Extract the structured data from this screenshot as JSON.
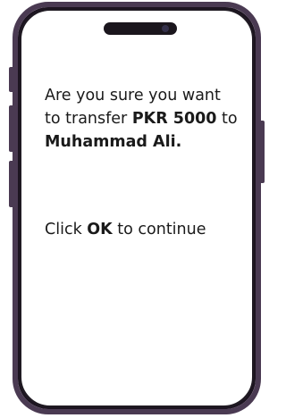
{
  "dialog": {
    "line1": "Are you sure you want",
    "line2_prefix": "to transfer ",
    "amount": "PKR 5000",
    "line2_suffix": " to",
    "recipient": "Muhammad Ali.",
    "continue_prefix": "Click ",
    "continue_key": "OK",
    "continue_suffix": " to continue"
  },
  "colors": {
    "frame": "#4a3a52",
    "text": "#1a1a1a",
    "background": "#ffffff"
  }
}
